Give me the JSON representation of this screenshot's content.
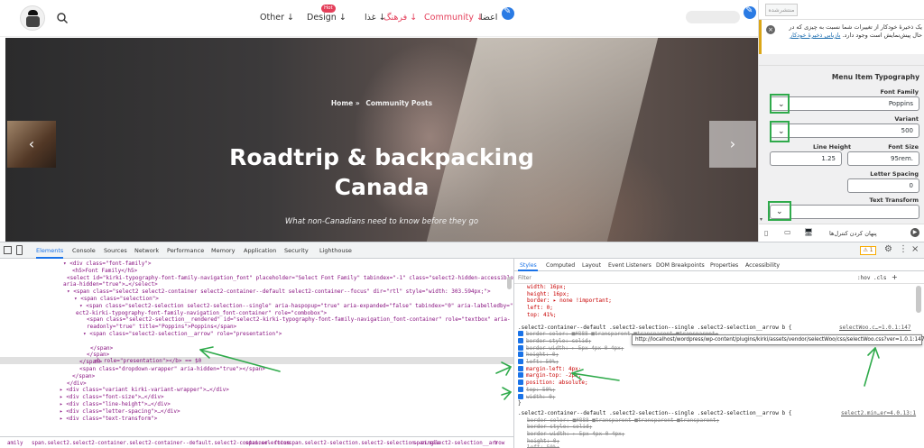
{
  "colors": {
    "accent": "#e43f5a",
    "annotation": "#2faa4b",
    "devtools_blue": "#1a73e8"
  },
  "site": {
    "logo_icon": "avatar-logo-icon",
    "search_icon": "search-icon",
    "nav": {
      "other": "Other ↓",
      "design": "Design ↓",
      "food": "غذا ↓",
      "hot_badge": "Hot",
      "culture": "فرهنگ ↓",
      "community": "Community ↓",
      "members": "اعضا"
    }
  },
  "hero": {
    "breadcrumb_home": "Home »",
    "breadcrumb_current": "Community Posts",
    "title_line1": "Roadtrip & backpacking",
    "title_line2": "Canada",
    "subtitle": "What non-Canadians need to know before they go",
    "prev_arrow": "‹",
    "next_arrow": "›"
  },
  "customizer": {
    "publish_label": "منتشرشده",
    "notice_text": "یک ذخیرهٔ خودکار از تغییرات شما نسبت به چیزی که در حال پیش‌نمایش است وجود دارد.",
    "notice_link": "بازیابی ذخیرهٔ خودکار",
    "section_title": "Menu Item Typography",
    "font_family_label": "Font Family",
    "font_family_value": "Poppins",
    "variant_label": "Variant",
    "variant_value": "500",
    "line_height_label": "Line Height",
    "line_height_value": "1.25",
    "font_size_label": "Font Size",
    "font_size_value": "95rem.",
    "letter_spacing_label": "Letter Spacing",
    "letter_spacing_value": "0",
    "text_transform_label": "Text Transform",
    "hide_controls_label": "پنهان کردن کنترل‌ها"
  },
  "devtools": {
    "tabs": [
      "Elements",
      "Console",
      "Sources",
      "Network",
      "Performance",
      "Memory",
      "Application",
      "Security",
      "Lighthouse"
    ],
    "warning_count": "⚠ 1",
    "elements": [
      {
        "indent": 70,
        "html": "▾ <div class=\"font-family\">"
      },
      {
        "indent": 80,
        "html": "<h5>Font Family</h5>"
      },
      {
        "indent": 74,
        "html": "<select id=\"kirki-typography-font-family-navigation_font\" placeholder=\"Select Font Family\" tabindex=\"-1\" class=\"select2-hidden-accessible\""
      },
      {
        "indent": 70,
        "html": "aria-hidden=\"true\">…</select>"
      },
      {
        "indent": 74,
        "html": "▾ <span class=\"select2 select2-container select2-container--default select2-container--focus\" dir=\"rtl\" style=\"width: 303.594px;\">"
      },
      {
        "indent": 82,
        "html": "▾ <span class=\"selection\">"
      },
      {
        "indent": 88,
        "html": "▾ <span class=\"select2-selection select2-selection--single\" aria-haspopup=\"true\" aria-expanded=\"false\" tabindex=\"0\" aria-labelledby=\"sel"
      },
      {
        "indent": 84,
        "html": "ect2-kirki-typography-font-family-navigation_font-container\" role=\"combobox\">"
      },
      {
        "indent": 96,
        "html": "<span class=\"select2-selection__rendered\" id=\"select2-kirki-typography-font-family-navigation_font-container\" role=\"textbox\" aria-"
      },
      {
        "indent": 96,
        "html": "readonly=\"true\" title=\"Poppins\">Poppins</span>"
      },
      {
        "indent": 92,
        "html": "▾ <span class=\"select2-selection__arrow\" role=\"presentation\">"
      },
      {
        "indent": 104,
        "html": "<b role=\"presentation\"></b> == $0"
      },
      {
        "indent": 100,
        "html": "</span>"
      },
      {
        "indent": 96,
        "html": "</span>"
      },
      {
        "indent": 88,
        "html": "</span>"
      },
      {
        "indent": 88,
        "html": "<span class=\"dropdown-wrapper\" aria-hidden=\"true\"></span>"
      },
      {
        "indent": 80,
        "html": "</span>"
      },
      {
        "indent": 74,
        "html": "</div>"
      },
      {
        "indent": 66,
        "html": "▸ <div class=\"variant kirki-variant-wrapper\">…</div>"
      },
      {
        "indent": 66,
        "html": "▸ <div class=\"font-size\">…</div>"
      },
      {
        "indent": 66,
        "html": "▸ <div class=\"line-height\">…</div>"
      },
      {
        "indent": 66,
        "html": "▸ <div class=\"letter-spacing\">…</div>"
      },
      {
        "indent": 66,
        "html": "▸ <div class=\"text-transform\">"
      }
    ],
    "breadcrumbs": [
      "amily",
      "span.select2.select2-container.select2-container--default.select2-container--focus",
      "span.selection",
      "span.select2-selection.select2-selection--single",
      "span.select2-selection__arrow",
      "b"
    ],
    "styles_tabs": [
      "Styles",
      "Computed",
      "Layout",
      "Event Listeners",
      "DOM Breakpoints",
      "Properties",
      "Accessibility"
    ],
    "filter_placeholder": "Filter",
    "filter_hov": ":hov",
    "filter_cls": ".cls",
    "filter_plus": "+",
    "css_top": [
      "width: 16px;",
      "height: 16px;",
      "border: ▸ none !important;",
      "left: 0;",
      "top: 41%;"
    ],
    "rule1_selector": ".select2-container--default .select2-selection--single .select2-selection__arrow b {",
    "rule1_source": "selectWoo.c…=1.0.1:147",
    "rule1_props": [
      {
        "text": "border-color: ■#888 ■transparent ■transparent ■transparent;",
        "struck": true
      },
      {
        "text": "border-style: solid;",
        "struck": true
      },
      {
        "text": "border-width: ▸ 5px 4px 0 4px;",
        "struck": true
      },
      {
        "text": "height: 0;",
        "struck": true
      },
      {
        "text": "left: 50%;",
        "struck": true
      },
      {
        "text": "margin-left: 4px;",
        "struck": false
      },
      {
        "text": "margin-top: -2px;",
        "struck": false
      },
      {
        "text": "position: absolute;",
        "struck": false
      },
      {
        "text": "top: 50%;",
        "struck": true
      },
      {
        "text": "width: 0;",
        "struck": true
      }
    ],
    "rule1_close": "}",
    "tooltip_url": "http://localhost/wordpress/wp-content/plugins/kirki/assets/vendor/selectWoo/css/selectWoo.css?ver=1.0.1:147",
    "rule2_selector": ".select2-container--default .select2-selection--single .select2-selection__arrow b {",
    "rule2_source": "select2.min…er=4.0.13:1",
    "rule2_props": [
      {
        "text": "border-color: ■#888 ■transparent ■transparent ■transparent;",
        "struck": true
      },
      {
        "text": "border-style: solid;",
        "struck": true
      },
      {
        "text": "border-width: ▸ 5px 4px 0 4px;",
        "struck": true
      },
      {
        "text": "height: 0;",
        "struck": true
      },
      {
        "text": "left: 50%;",
        "struck": true
      }
    ]
  }
}
